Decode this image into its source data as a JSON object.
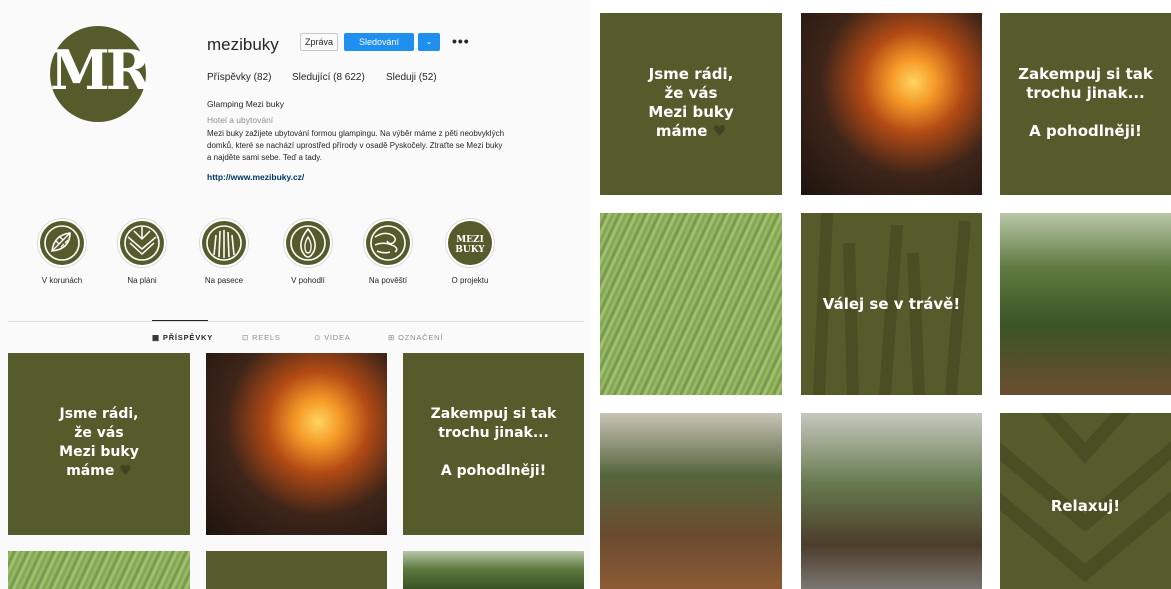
{
  "profile": {
    "avatar_monogram": "MR",
    "username": "mezibuky",
    "message_label": "Zpráva",
    "following_label": "Sledování",
    "dropdown_glyph": "⌄",
    "more_glyph": "•••",
    "stats": {
      "posts": "Příspěvky (82)",
      "followers": "Sledující (8 622)",
      "following": "Sleduji (52)"
    },
    "bio_name": "Glamping Mezi buky",
    "bio_category": "Hotel a ubytování",
    "bio_lines": [
      "Mezi buky zažijete ubytování formou glampingu. Na výběr máme z pěti neobvyklých",
      "domků, které se nachází uprostřed přírody v osadě Pyskočely. Ztraťte se Mezi buky",
      "a najděte sami sebe. Teď a tady."
    ],
    "link": "http://www.mezibuky.cz/"
  },
  "highlights": [
    {
      "label": "V korunách",
      "icon": "leaf-icon"
    },
    {
      "label": "Na pláni",
      "icon": "chevron-pattern-icon"
    },
    {
      "label": "Na pasece",
      "icon": "grass-icon"
    },
    {
      "label": "V pohodlí",
      "icon": "flame-icon"
    },
    {
      "label": "Na pověští",
      "icon": "wind-swirl-icon"
    },
    {
      "label": "O projektu",
      "icon": "mezi-buky-logo",
      "logo_lines": [
        "MEZI",
        "BUKY"
      ]
    }
  ],
  "tabs": [
    {
      "label": "PŘÍSPĚVKY",
      "icon": "grid-icon",
      "active": true
    },
    {
      "label": "REELS",
      "icon": "reels-icon",
      "active": false
    },
    {
      "label": "VIDEA",
      "icon": "video-icon",
      "active": false
    },
    {
      "label": "OZNAČENÍ",
      "icon": "tag-icon",
      "active": false
    }
  ],
  "posts": {
    "welcome_lines": [
      "Jsme rádi,",
      "že vás",
      "Mezi buky",
      "máme"
    ],
    "heart_glyph": "♥",
    "camp_lines": [
      "Zakempuj si tak",
      "trochu jinak...",
      "",
      "A pohodlněji!"
    ],
    "grass_text": "Válej se v trávě!",
    "relax_text": "Relaxuj!"
  },
  "colors": {
    "brand_olive": "#565b2b",
    "follow_blue": "#1f8ff0",
    "link": "#00376b"
  }
}
